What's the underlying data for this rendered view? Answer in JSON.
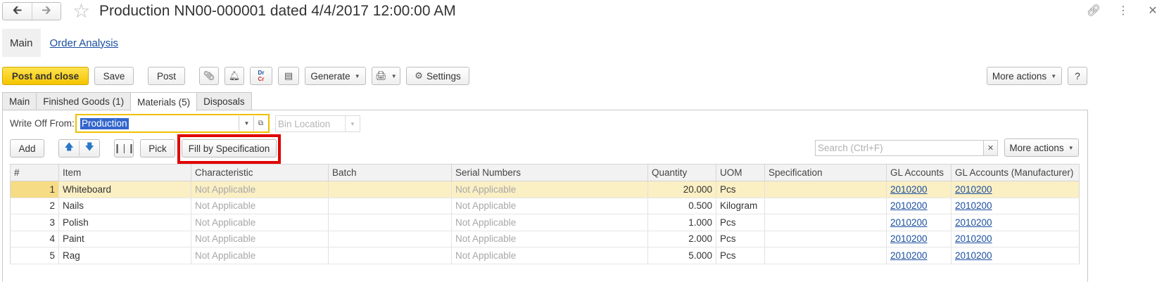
{
  "window": {
    "title": "Production NN00-000001 dated 4/4/2017 12:00:00 AM",
    "back_icon": "back-arrow-icon",
    "forward_icon": "forward-arrow-icon",
    "favorite_icon": "star-icon",
    "link_icon": "link-icon",
    "menu_icon": "kebab-menu-icon",
    "close_icon": "close-icon"
  },
  "section_tabs": [
    {
      "label": "Main",
      "active": true
    },
    {
      "label": "Order Analysis",
      "active": false
    }
  ],
  "toolbar": {
    "post_and_close": "Post and close",
    "save": "Save",
    "post": "Post",
    "generate": "Generate",
    "settings": "Settings",
    "more_actions": "More actions",
    "help": "?",
    "dr": "Dr",
    "cr": "Cr"
  },
  "inner_tabs": [
    {
      "label": "Main",
      "active": false
    },
    {
      "label": "Finished Goods (1)",
      "active": false
    },
    {
      "label": "Materials (5)",
      "active": true
    },
    {
      "label": "Disposals",
      "active": false
    }
  ],
  "materials": {
    "write_off_label": "Write Off From:",
    "write_off_value": "Production",
    "bin_location_placeholder": "Bin Location",
    "add": "Add",
    "pick": "Pick",
    "fill_by_specification": "Fill by Specification",
    "search_placeholder": "Search (Ctrl+F)",
    "more_actions": "More actions",
    "columns": [
      "#",
      "Item",
      "Characteristic",
      "Batch",
      "Serial Numbers",
      "Quantity",
      "UOM",
      "Specification",
      "GL Accounts",
      "GL Accounts (Manufacturer)"
    ],
    "rows": [
      {
        "n": "1",
        "item": "Whiteboard",
        "characteristic": "Not Applicable",
        "batch": "",
        "serial": "Not Applicable",
        "qty": "20.000",
        "uom": "Pcs",
        "spec": "",
        "gl": "2010200",
        "gl_m": "2010200"
      },
      {
        "n": "2",
        "item": "Nails",
        "characteristic": "Not Applicable",
        "batch": "",
        "serial": "Not Applicable",
        "qty": "0.500",
        "uom": "Kilogram",
        "spec": "",
        "gl": "2010200",
        "gl_m": "2010200"
      },
      {
        "n": "3",
        "item": "Polish",
        "characteristic": "Not Applicable",
        "batch": "",
        "serial": "Not Applicable",
        "qty": "1.000",
        "uom": "Pcs",
        "spec": "",
        "gl": "2010200",
        "gl_m": "2010200"
      },
      {
        "n": "4",
        "item": "Paint",
        "characteristic": "Not Applicable",
        "batch": "",
        "serial": "Not Applicable",
        "qty": "2.000",
        "uom": "Pcs",
        "spec": "",
        "gl": "2010200",
        "gl_m": "2010200"
      },
      {
        "n": "5",
        "item": "Rag",
        "characteristic": "Not Applicable",
        "batch": "",
        "serial": "Not Applicable",
        "qty": "5.000",
        "uom": "Pcs",
        "spec": "",
        "gl": "2010200",
        "gl_m": "2010200"
      }
    ]
  },
  "colors": {
    "primary_button": "#f4c400",
    "link": "#1a4fa0",
    "highlight": "#e00000",
    "selected_row": "#fbefc4"
  }
}
